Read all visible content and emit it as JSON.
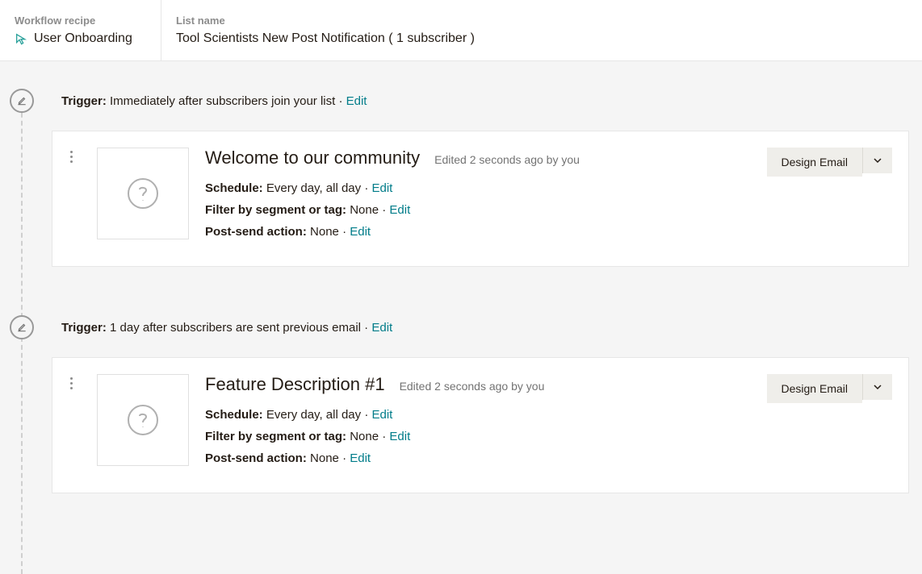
{
  "header": {
    "recipe_label": "Workflow recipe",
    "recipe_value": "User Onboarding",
    "list_label": "List name",
    "list_value": "Tool Scientists New Post Notification ( 1 subscriber )"
  },
  "labels": {
    "trigger": "Trigger:",
    "edit": "Edit",
    "schedule": "Schedule:",
    "filter": "Filter by segment or tag:",
    "post_send": "Post-send action:",
    "design_email": "Design Email"
  },
  "steps": [
    {
      "trigger_text": "Immediately after subscribers join your list",
      "title": "Welcome to our community",
      "edited": "Edited 2 seconds ago by you",
      "schedule": "Every day, all day",
      "filter": "None",
      "post_send": "None"
    },
    {
      "trigger_text": "1 day after subscribers are sent previous email",
      "title": "Feature Description #1",
      "edited": "Edited 2 seconds ago by you",
      "schedule": "Every day, all day",
      "filter": "None",
      "post_send": "None"
    }
  ]
}
